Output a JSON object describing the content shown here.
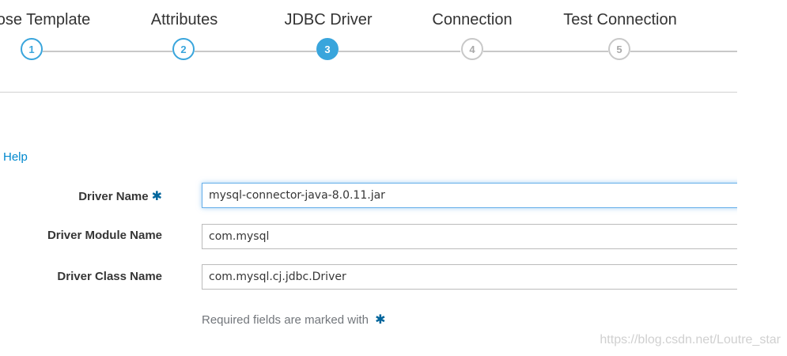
{
  "wizard": {
    "steps": [
      {
        "label": "ose Template",
        "number": "1",
        "state": "done"
      },
      {
        "label": "Attributes",
        "number": "2",
        "state": "done"
      },
      {
        "label": "JDBC Driver",
        "number": "3",
        "state": "active"
      },
      {
        "label": "Connection",
        "number": "4",
        "state": "pending"
      },
      {
        "label": "Test Connection",
        "number": "5",
        "state": "pending"
      }
    ]
  },
  "help": {
    "label": "Help"
  },
  "form": {
    "fields": [
      {
        "label": "Driver Name",
        "value": "mysql-connector-java-8.0.11.jar",
        "required": true
      },
      {
        "label": "Driver Module Name",
        "value": "com.mysql",
        "required": false
      },
      {
        "label": "Driver Class Name",
        "value": "com.mysql.cj.jdbc.Driver",
        "required": false
      }
    ],
    "required_note": "Required fields are marked with"
  },
  "icons": {
    "required": "asterisk-icon"
  },
  "colors": {
    "accent": "#39a5dc",
    "link": "#0088ce",
    "required_star": "#00659c"
  },
  "watermark": "https://blog.csdn.net/Loutre_star"
}
